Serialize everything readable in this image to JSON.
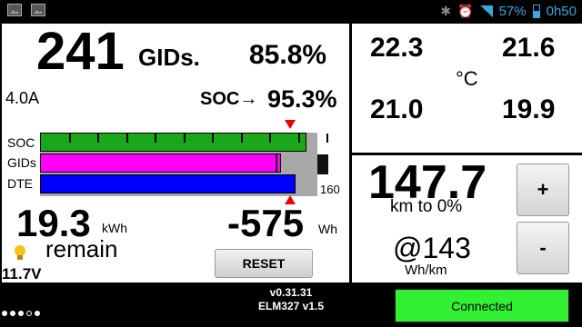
{
  "status_bar": {
    "battery_percent": "57%",
    "time": "0h50",
    "icons": [
      "image-icon",
      "image-icon",
      "bluetooth-icon",
      "alarm-icon",
      "signal-icon",
      "battery-icon"
    ]
  },
  "main": {
    "gids_value": "241",
    "gids_unit": "GIDs.",
    "gids_percent": "85.8%",
    "current": "4.0A",
    "soc_label": "SOC→",
    "soc_value": "95.3%",
    "bars": [
      {
        "label": "SOC",
        "color": "#1aa81a",
        "fill": 0.96
      },
      {
        "label": "GIDs",
        "color": "#ff00ff",
        "fill": 0.87,
        "marker": 0.85
      },
      {
        "label": "DTE",
        "color": "#0000ff",
        "fill": 0.92
      }
    ],
    "bar_max": "160",
    "energy_value": "19.3",
    "energy_unit": "kWh",
    "energy_caption": "remain",
    "voltage": "11.7V",
    "power_value": "-575",
    "power_unit": "Wh",
    "reset_label": "RESET"
  },
  "temps": {
    "tl": "22.3",
    "tr": "21.6",
    "bl": "21.0",
    "br": "19.9",
    "unit": "°C"
  },
  "range": {
    "value": "147.7",
    "caption": "km to 0%",
    "efficiency": "@143",
    "efficiency_unit": "Wh/km",
    "plus_label": "+",
    "minus_label": "-"
  },
  "footer": {
    "version": "v0.31.31",
    "adapter": "ELM327 v1.5",
    "connection": "Connected",
    "connection_color": "#32f032"
  }
}
